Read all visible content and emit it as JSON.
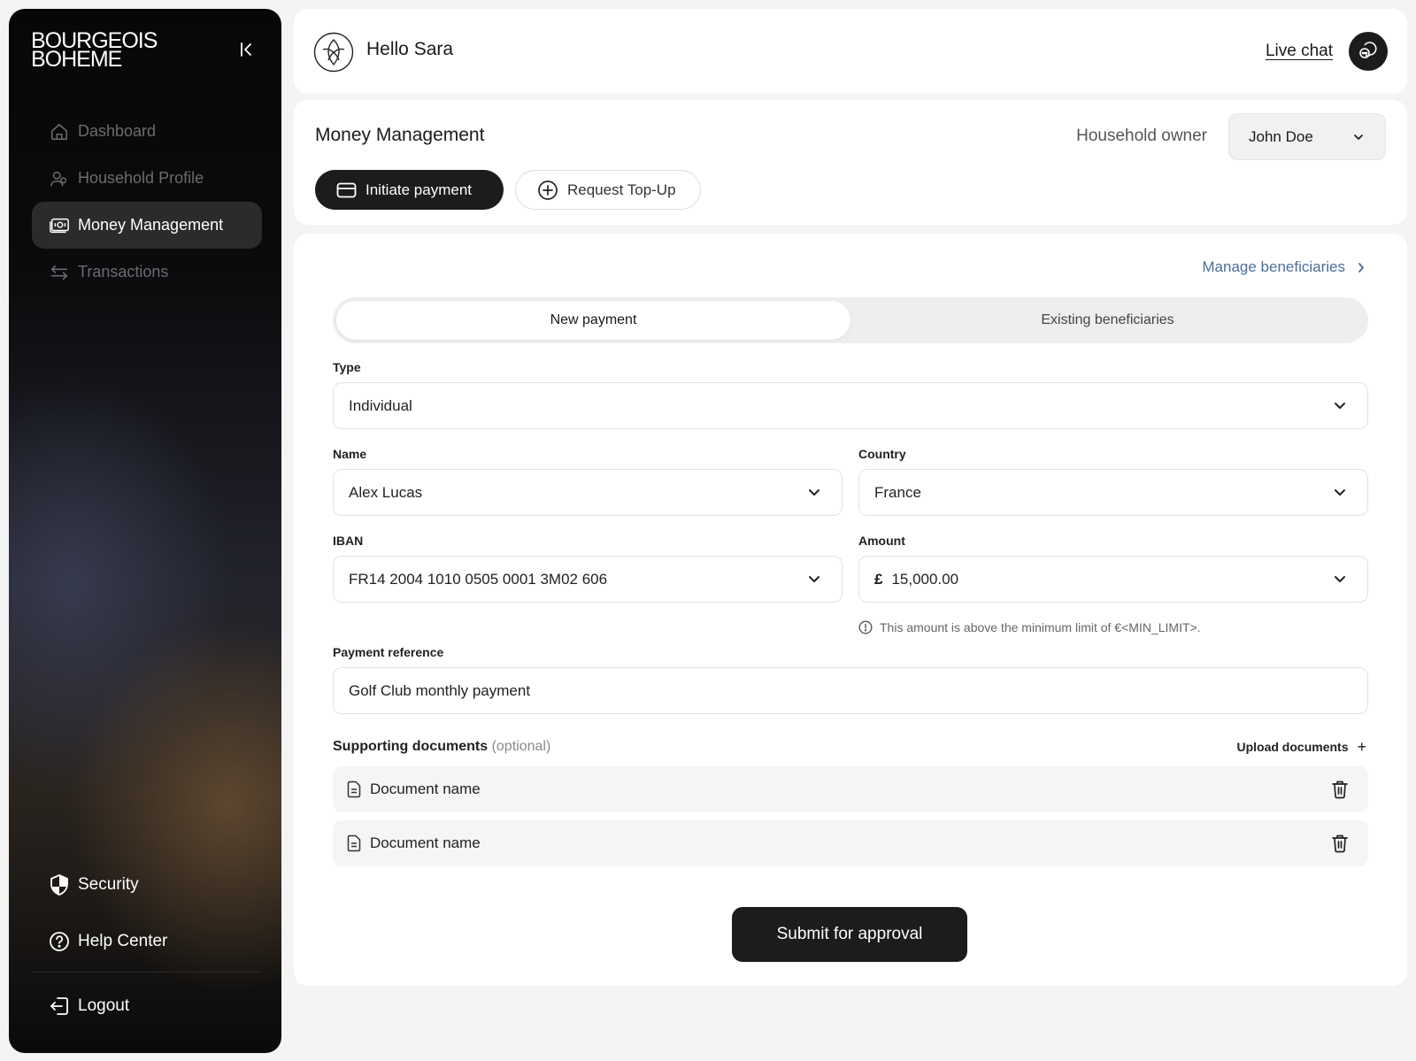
{
  "brand": {
    "line1": "BOURGEOIS",
    "line2": "BOHEME"
  },
  "sidebar": {
    "items": [
      {
        "label": "Dashboard",
        "icon": "home-icon"
      },
      {
        "label": "Household Profile",
        "icon": "users-icon"
      },
      {
        "label": "Money Management",
        "icon": "cash-icon",
        "active": true
      },
      {
        "label": "Transactions",
        "icon": "arrows-icon"
      }
    ],
    "bottom": [
      {
        "label": "Security",
        "icon": "shield-icon"
      },
      {
        "label": "Help Center",
        "icon": "help-icon"
      },
      {
        "label": "Logout",
        "icon": "logout-icon"
      }
    ]
  },
  "header": {
    "greeting": "Hello Sara",
    "live_chat": "Live chat"
  },
  "money": {
    "title": "Money Management",
    "owner_label": "Household owner",
    "owner_value": "John Doe",
    "initiate": "Initiate payment",
    "topup": "Request Top-Up"
  },
  "form": {
    "manage_link": "Manage beneficiaries",
    "tabs": [
      "New payment",
      "Existing beneficiaries"
    ],
    "type_label": "Type",
    "type_value": "Individual",
    "name_label": "Name",
    "name_value": "Alex Lucas",
    "country_label": "Country",
    "country_value": "France",
    "iban_label": "IBAN",
    "iban_value": "FR14 2004 1010 0505 0001 3M02 606",
    "amount_label": "Amount",
    "amount_currency": "£",
    "amount_value": "15,000.00",
    "amount_hint": "This amount is above the minimum limit of €<MIN_LIMIT>.",
    "reference_label": "Payment reference",
    "reference_value": "Golf Club monthly payment",
    "docs_title": "Supporting documents",
    "docs_optional": "(optional)",
    "upload": "Upload documents",
    "upload_plus": "+",
    "documents": [
      "Document name",
      "Document name"
    ],
    "submit": "Submit for approval"
  }
}
